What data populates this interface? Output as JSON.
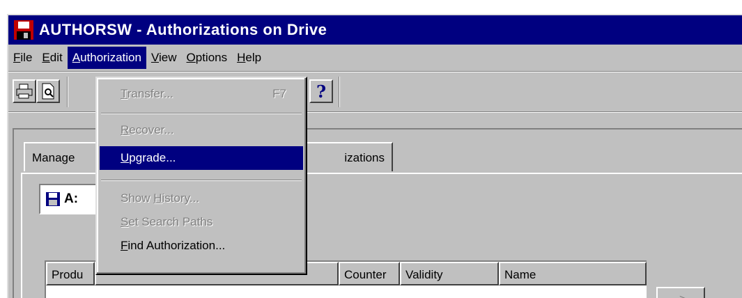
{
  "window": {
    "title": "AUTHORSW - Authorizations on Drive"
  },
  "menubar": {
    "items": [
      {
        "label": "File",
        "hotkey": "F",
        "rest": "ile"
      },
      {
        "label": "Edit",
        "hotkey": "E",
        "rest": "dit"
      },
      {
        "label": "Authorization",
        "hotkey": "A",
        "rest": "uthorization"
      },
      {
        "label": "View",
        "hotkey": "V",
        "rest": "iew"
      },
      {
        "label": "Options",
        "hotkey": "O",
        "rest": "ptions"
      },
      {
        "label": "Help",
        "hotkey": "H",
        "rest": "elp"
      }
    ],
    "active": "Authorization"
  },
  "toolbar": {
    "icons": [
      "print-icon",
      "print-preview-icon",
      "help-icon"
    ],
    "help_glyph": "?"
  },
  "tabs": [
    {
      "label": "Manage"
    },
    {
      "label": "izations"
    }
  ],
  "drive": {
    "label": "A:"
  },
  "list": {
    "columns": [
      {
        "label": "Produ"
      },
      {
        "label": ""
      },
      {
        "label": "Counter"
      },
      {
        "label": "Validity"
      },
      {
        "label": "Name"
      }
    ]
  },
  "transfer_button": {
    "label": "->"
  },
  "dropdown": {
    "transfer": {
      "pre": "",
      "hotkey": "T",
      "rest": "ransfer...",
      "shortcut": "F7",
      "enabled": false
    },
    "recover": {
      "pre": "",
      "hotkey": "R",
      "rest": "ecover...",
      "enabled": false
    },
    "upgrade": {
      "pre": "",
      "hotkey": "U",
      "rest": "pgrade...",
      "enabled": true,
      "highlighted": true
    },
    "show_history": {
      "pre": "Show ",
      "hotkey": "H",
      "rest": "istory...",
      "enabled": false
    },
    "set_search_paths": {
      "pre": "",
      "hotkey": "S",
      "rest": "et Search Paths",
      "enabled": false
    },
    "find_authorization": {
      "pre": "",
      "hotkey": "F",
      "rest": "ind Authorization...",
      "enabled": true
    }
  },
  "colors": {
    "titlebar": "#000080",
    "face": "#c0c0c0",
    "highlight": "#000080",
    "app_icon": "#c00000"
  }
}
